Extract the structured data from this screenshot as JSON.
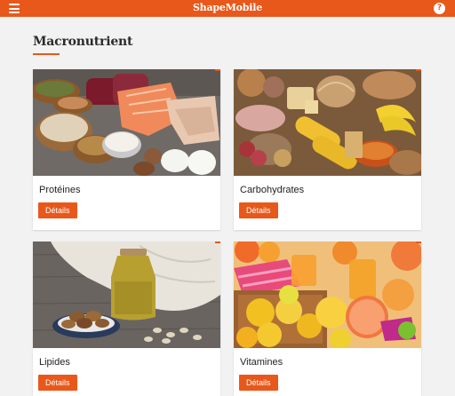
{
  "app": {
    "title": "ShapeMobile"
  },
  "header": {
    "menu_icon": "hamburger-menu-icon",
    "help_icon": "question-mark-icon",
    "help_glyph": "?"
  },
  "section": {
    "title": "Macronutrient"
  },
  "colors": {
    "accent": "#e8581a",
    "background": "#f2f2f2",
    "card": "#ffffff"
  },
  "cards": [
    {
      "label": "Protéines",
      "button": "Détails",
      "image": "protein-foods-photo"
    },
    {
      "label": "Carbohydrates",
      "button": "Détails",
      "image": "carbohydrate-foods-photo"
    },
    {
      "label": "Lipides",
      "button": "Détails",
      "image": "lipid-foods-photo"
    },
    {
      "label": "Vitamines",
      "button": "Détails",
      "image": "vitamin-fruits-photo"
    }
  ]
}
